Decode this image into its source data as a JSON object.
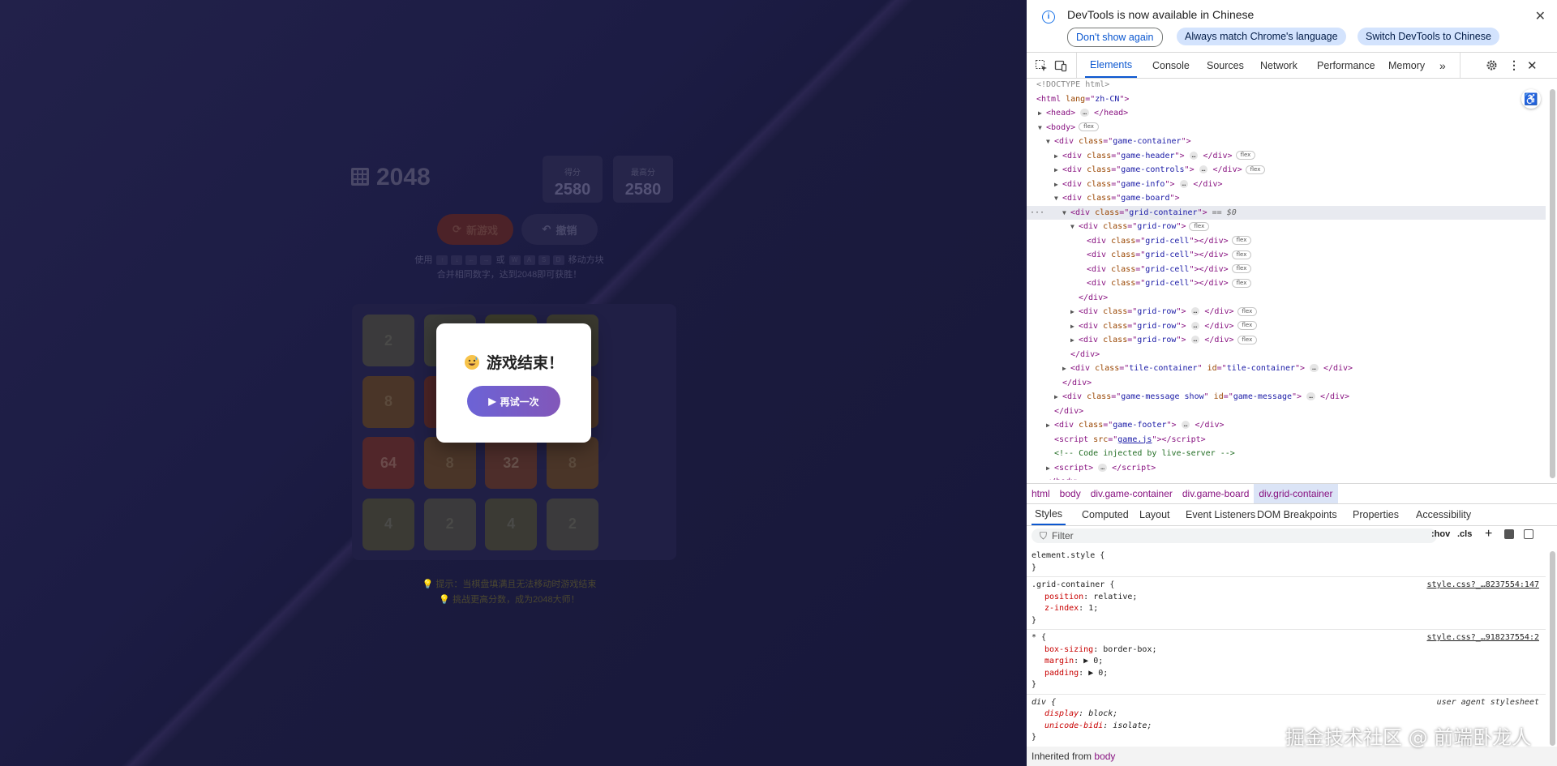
{
  "game": {
    "title": "2048",
    "score_label": "得分",
    "score_value": "2580",
    "best_label": "最高分",
    "best_value": "2580",
    "new_game_label": "新游戏",
    "undo_label": "撤销",
    "info_use": "使用",
    "info_or": "或",
    "info_move": "移动方块",
    "info_goal": "合并相同数字，达到2048即可获胜！",
    "tiles": [
      {
        "value": "2",
        "bg": "#3b3a3c",
        "color": "#4a4a48"
      },
      {
        "value": "",
        "bg": "#3a3b38",
        "color": "#4a4a48"
      },
      {
        "value": "",
        "bg": "#3a3a2a",
        "color": "#4a4a48"
      },
      {
        "value": "",
        "bg": "#3a392f",
        "color": "#4a4a48"
      },
      {
        "value": "8",
        "bg": "#4a3528",
        "color": "#5b4a3c"
      },
      {
        "value": "",
        "bg": "#4b2425",
        "color": "#5b4a3c"
      },
      {
        "value": "",
        "bg": "#4a3226",
        "color": "#5b4a3c"
      },
      {
        "value": "",
        "bg": "#4a3426",
        "color": "#5b4a3c"
      },
      {
        "value": "64",
        "bg": "#51262a",
        "color": "#6a4a4a"
      },
      {
        "value": "8",
        "bg": "#4a3528",
        "color": "#5b4a3c"
      },
      {
        "value": "32",
        "bg": "#4d2d2a",
        "color": "#66504a"
      },
      {
        "value": "8",
        "bg": "#4a3528",
        "color": "#5b4a3c"
      },
      {
        "value": "4",
        "bg": "#3b3a34",
        "color": "#4a4a48"
      },
      {
        "value": "2",
        "bg": "#3b3a3c",
        "color": "#4a4a48"
      },
      {
        "value": "4",
        "bg": "#3b3a34",
        "color": "#4a4a48"
      },
      {
        "value": "2",
        "bg": "#3b3a3c",
        "color": "#4a4a48"
      }
    ],
    "footer_line1": "提示：当棋盘填满且无法移动时游戏结束",
    "footer_line2": "挑战更高分数，成为2048大师！",
    "message_title": "游戏结束！",
    "retry_label": "再试一次"
  },
  "devtools": {
    "infobar_text": "DevTools is now available in Chinese",
    "btn_dont_show": "Don't show again",
    "btn_match": "Always match Chrome's language",
    "btn_switch": "Switch DevTools to Chinese",
    "tabs": [
      "Elements",
      "Console",
      "Sources",
      "Network",
      "Performance",
      "Memory"
    ],
    "dom": {
      "doctype": "<!DOCTYPE html>",
      "html_lang": "zh-CN",
      "head": "head",
      "body": "body",
      "game_container": "game-container",
      "game_header": "game-header",
      "game_controls": "game-controls",
      "game_info": "game-info",
      "game_board": "game-board",
      "grid_container": "grid-container",
      "grid_row": "grid-row",
      "grid_cell": "grid-cell",
      "tile_container": "tile-container",
      "game_message_class": "game-message show",
      "game_message_id": "game-message",
      "game_footer": "game-footer",
      "script_src": "game.js",
      "comment": "<!-- Code injected by live-server -->",
      "eq0": "== $0",
      "flex": "flex"
    },
    "breadcrumb": [
      "html",
      "body",
      "div.game-container",
      "div.game-board",
      "div.grid-container"
    ],
    "subtabs": [
      "Styles",
      "Computed",
      "Layout",
      "Event Listeners",
      "DOM Breakpoints",
      "Properties",
      "Accessibility"
    ],
    "filter_placeholder": "Filter",
    "hov": ":hov",
    "cls": ".cls",
    "styles": {
      "element_style": "element.style {",
      "grid_selector": ".grid-container {",
      "grid_src": "style.css?_…8237554:147",
      "grid_props": [
        [
          "position",
          "relative;"
        ],
        [
          "z-index",
          "1;"
        ]
      ],
      "star_selector": "* {",
      "star_src": "style.css?_…918237554:2",
      "star_props": [
        [
          "box-sizing",
          "border-box;"
        ],
        [
          "margin",
          "▶ 0;"
        ],
        [
          "padding",
          "▶ 0;"
        ]
      ],
      "div_selector": "div {",
      "div_src": "user agent stylesheet",
      "div_props": [
        [
          "display",
          "block;"
        ],
        [
          "unicode-bidi",
          "isolate;"
        ]
      ],
      "close": "}",
      "inherited_label": "Inherited from",
      "inherited_tag": "body"
    }
  },
  "watermark": "掘金技术社区 @ 前端卧龙人"
}
